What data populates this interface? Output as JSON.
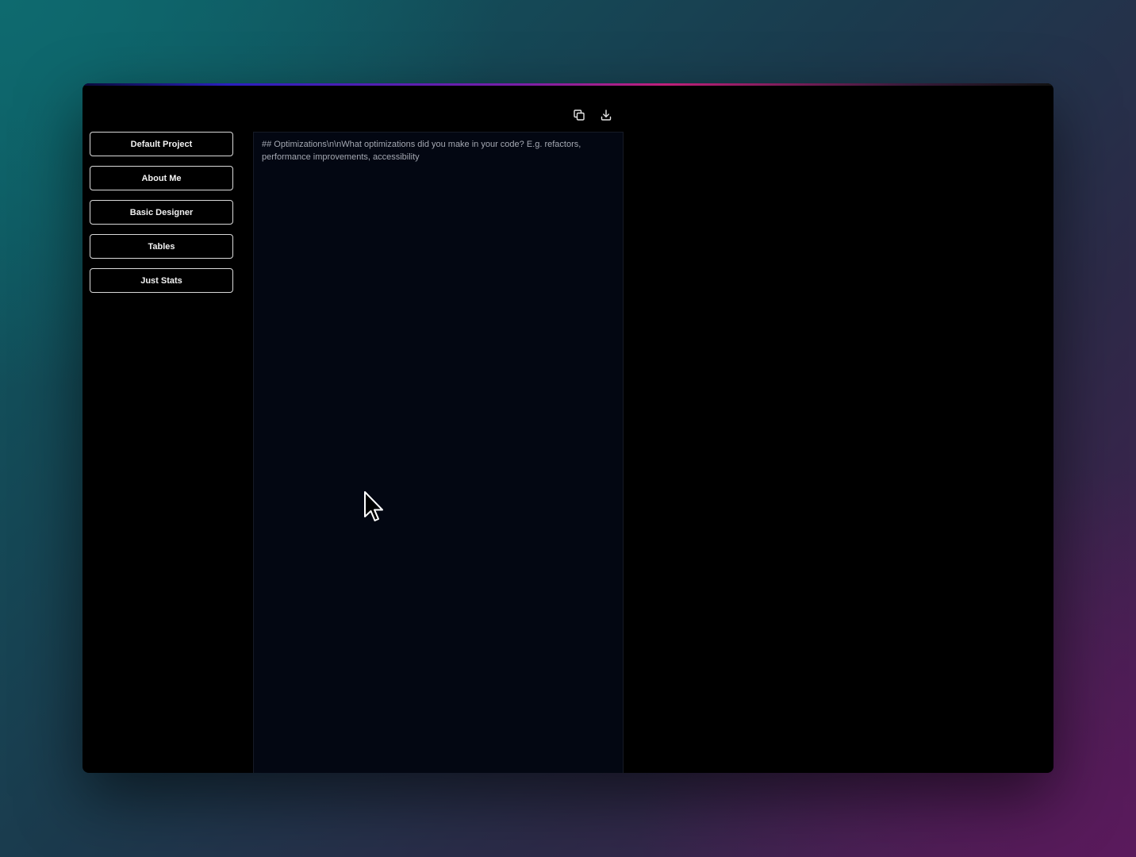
{
  "sidebar": {
    "items": [
      {
        "label": "Default Project"
      },
      {
        "label": "About Me"
      },
      {
        "label": "Basic Designer"
      },
      {
        "label": "Tables"
      },
      {
        "label": "Just Stats"
      }
    ]
  },
  "toolbar": {
    "copy_icon": "copy-icon",
    "download_icon": "download-icon"
  },
  "editor": {
    "content": "## Optimizations\\n\\nWhat optimizations did you make in your code? E.g. refactors, performance improvements, accessibility"
  },
  "colors": {
    "window_bg": "#000000",
    "editor_bg": "#030712",
    "button_border": "#d9d9d9",
    "text_muted": "#a4a8b2"
  }
}
